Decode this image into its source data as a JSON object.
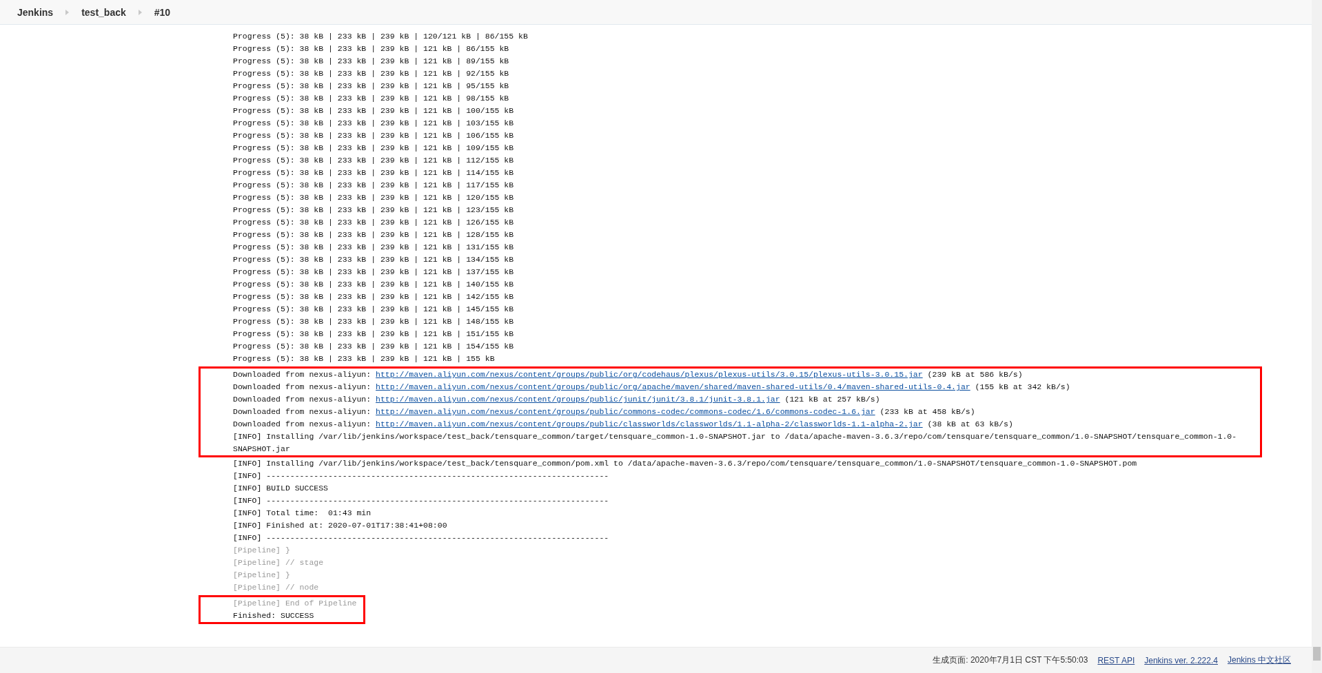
{
  "breadcrumbs": [
    {
      "label": "Jenkins"
    },
    {
      "label": "test_back"
    },
    {
      "label": "#10"
    }
  ],
  "log": [
    {
      "highlighted": false,
      "lines": [
        {
          "kind": "text",
          "text": "Progress (5): 38 kB | 233 kB | 239 kB | 120/121 kB | 86/155 kB"
        },
        {
          "kind": "text",
          "text": "Progress (5): 38 kB | 233 kB | 239 kB | 121 kB | 86/155 kB"
        },
        {
          "kind": "text",
          "text": "Progress (5): 38 kB | 233 kB | 239 kB | 121 kB | 89/155 kB"
        },
        {
          "kind": "text",
          "text": "Progress (5): 38 kB | 233 kB | 239 kB | 121 kB | 92/155 kB"
        },
        {
          "kind": "text",
          "text": "Progress (5): 38 kB | 233 kB | 239 kB | 121 kB | 95/155 kB"
        },
        {
          "kind": "text",
          "text": "Progress (5): 38 kB | 233 kB | 239 kB | 121 kB | 98/155 kB"
        },
        {
          "kind": "text",
          "text": "Progress (5): 38 kB | 233 kB | 239 kB | 121 kB | 100/155 kB"
        },
        {
          "kind": "text",
          "text": "Progress (5): 38 kB | 233 kB | 239 kB | 121 kB | 103/155 kB"
        },
        {
          "kind": "text",
          "text": "Progress (5): 38 kB | 233 kB | 239 kB | 121 kB | 106/155 kB"
        },
        {
          "kind": "text",
          "text": "Progress (5): 38 kB | 233 kB | 239 kB | 121 kB | 109/155 kB"
        },
        {
          "kind": "text",
          "text": "Progress (5): 38 kB | 233 kB | 239 kB | 121 kB | 112/155 kB"
        },
        {
          "kind": "text",
          "text": "Progress (5): 38 kB | 233 kB | 239 kB | 121 kB | 114/155 kB"
        },
        {
          "kind": "text",
          "text": "Progress (5): 38 kB | 233 kB | 239 kB | 121 kB | 117/155 kB"
        },
        {
          "kind": "text",
          "text": "Progress (5): 38 kB | 233 kB | 239 kB | 121 kB | 120/155 kB"
        },
        {
          "kind": "text",
          "text": "Progress (5): 38 kB | 233 kB | 239 kB | 121 kB | 123/155 kB"
        },
        {
          "kind": "text",
          "text": "Progress (5): 38 kB | 233 kB | 239 kB | 121 kB | 126/155 kB"
        },
        {
          "kind": "text",
          "text": "Progress (5): 38 kB | 233 kB | 239 kB | 121 kB | 128/155 kB"
        },
        {
          "kind": "text",
          "text": "Progress (5): 38 kB | 233 kB | 239 kB | 121 kB | 131/155 kB"
        },
        {
          "kind": "text",
          "text": "Progress (5): 38 kB | 233 kB | 239 kB | 121 kB | 134/155 kB"
        },
        {
          "kind": "text",
          "text": "Progress (5): 38 kB | 233 kB | 239 kB | 121 kB | 137/155 kB"
        },
        {
          "kind": "text",
          "text": "Progress (5): 38 kB | 233 kB | 239 kB | 121 kB | 140/155 kB"
        },
        {
          "kind": "text",
          "text": "Progress (5): 38 kB | 233 kB | 239 kB | 121 kB | 142/155 kB"
        },
        {
          "kind": "text",
          "text": "Progress (5): 38 kB | 233 kB | 239 kB | 121 kB | 145/155 kB"
        },
        {
          "kind": "text",
          "text": "Progress (5): 38 kB | 233 kB | 239 kB | 121 kB | 148/155 kB"
        },
        {
          "kind": "text",
          "text": "Progress (5): 38 kB | 233 kB | 239 kB | 121 kB | 151/155 kB"
        },
        {
          "kind": "text",
          "text": "Progress (5): 38 kB | 233 kB | 239 kB | 121 kB | 154/155 kB"
        },
        {
          "kind": "text",
          "text": "Progress (5): 38 kB | 233 kB | 239 kB | 121 kB | 155 kB"
        }
      ]
    },
    {
      "highlighted": true,
      "lines": [
        {
          "kind": "download",
          "prefix": "Downloaded from nexus-aliyun: ",
          "url": "http://maven.aliyun.com/nexus/content/groups/public/org/codehaus/plexus/plexus-utils/3.0.15/plexus-utils-3.0.15.jar",
          "suffix": " (239 kB at 586 kB/s)"
        },
        {
          "kind": "download",
          "prefix": "Downloaded from nexus-aliyun: ",
          "url": "http://maven.aliyun.com/nexus/content/groups/public/org/apache/maven/shared/maven-shared-utils/0.4/maven-shared-utils-0.4.jar",
          "suffix": " (155 kB at 342 kB/s)"
        },
        {
          "kind": "download",
          "prefix": "Downloaded from nexus-aliyun: ",
          "url": "http://maven.aliyun.com/nexus/content/groups/public/junit/junit/3.8.1/junit-3.8.1.jar",
          "suffix": " (121 kB at 257 kB/s)"
        },
        {
          "kind": "download",
          "prefix": "Downloaded from nexus-aliyun: ",
          "url": "http://maven.aliyun.com/nexus/content/groups/public/commons-codec/commons-codec/1.6/commons-codec-1.6.jar",
          "suffix": " (233 kB at 458 kB/s)"
        },
        {
          "kind": "download",
          "prefix": "Downloaded from nexus-aliyun: ",
          "url": "http://maven.aliyun.com/nexus/content/groups/public/classworlds/classworlds/1.1-alpha-2/classworlds-1.1-alpha-2.jar",
          "suffix": " (38 kB at 63 kB/s)"
        },
        {
          "kind": "text",
          "text": "[INFO] Installing /var/lib/jenkins/workspace/test_back/tensquare_common/target/tensquare_common-1.0-SNAPSHOT.jar to /data/apache-maven-3.6.3/repo/com/tensquare/tensquare_common/1.0-SNAPSHOT/tensquare_common-1.0-SNAPSHOT.jar"
        }
      ]
    },
    {
      "highlighted": false,
      "lines": [
        {
          "kind": "text",
          "text": "[INFO] Installing /var/lib/jenkins/workspace/test_back/tensquare_common/pom.xml to /data/apache-maven-3.6.3/repo/com/tensquare/tensquare_common/1.0-SNAPSHOT/tensquare_common-1.0-SNAPSHOT.pom"
        },
        {
          "kind": "text",
          "text": "[INFO] ------------------------------------------------------------------------"
        },
        {
          "kind": "text",
          "text": "[INFO] BUILD SUCCESS"
        },
        {
          "kind": "text",
          "text": "[INFO] ------------------------------------------------------------------------"
        },
        {
          "kind": "text",
          "text": "[INFO] Total time:  01:43 min"
        },
        {
          "kind": "text",
          "text": "[INFO] Finished at: 2020-07-01T17:38:41+08:00"
        },
        {
          "kind": "text",
          "text": "[INFO] ------------------------------------------------------------------------"
        },
        {
          "kind": "pipeline",
          "text": "[Pipeline] }"
        },
        {
          "kind": "pipeline",
          "text": "[Pipeline] // stage"
        },
        {
          "kind": "pipeline",
          "text": "[Pipeline] }"
        },
        {
          "kind": "pipeline",
          "text": "[Pipeline] // node"
        }
      ]
    },
    {
      "highlighted": true,
      "lines": [
        {
          "kind": "pipeline",
          "text": "[Pipeline] End of Pipeline"
        },
        {
          "kind": "text",
          "text": "Finished: SUCCESS"
        }
      ]
    }
  ],
  "footer": {
    "generated": "生成页面: 2020年7月1日 CST 下午5:50:03",
    "links": [
      "REST API",
      "Jenkins ver. 2.222.4",
      "Jenkins 中文社区"
    ]
  }
}
